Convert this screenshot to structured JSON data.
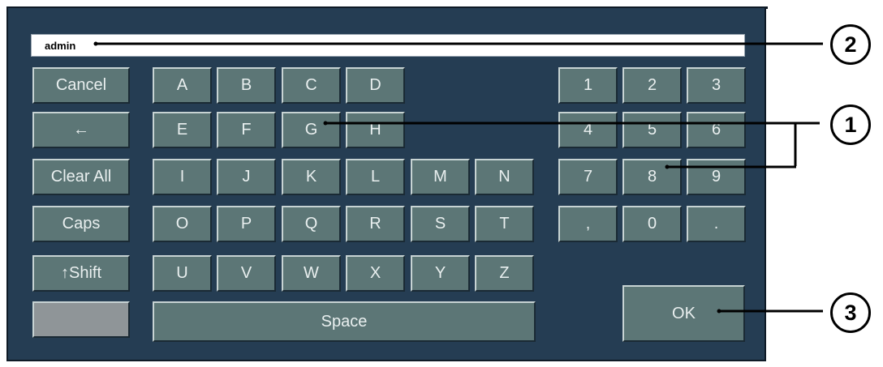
{
  "input": {
    "value": "admin"
  },
  "function_keys": [
    "Cancel",
    "←",
    "Clear All",
    "Caps",
    "↑Shift",
    ""
  ],
  "letter_rows": [
    [
      "A",
      "B",
      "C",
      "D"
    ],
    [
      "E",
      "F",
      "G",
      "H"
    ],
    [
      "I",
      "J",
      "K",
      "L",
      "M",
      "N"
    ],
    [
      "O",
      "P",
      "Q",
      "R",
      "S",
      "T"
    ],
    [
      "U",
      "V",
      "W",
      "X",
      "Y",
      "Z"
    ]
  ],
  "space_label": "Space",
  "numpad": [
    [
      "1",
      "2",
      "3"
    ],
    [
      "4",
      "5",
      "6"
    ],
    [
      "7",
      "8",
      "9"
    ],
    [
      ",",
      "0",
      "."
    ]
  ],
  "ok_label": "OK",
  "callouts": [
    "2",
    "1",
    "3"
  ],
  "colors": {
    "panel": "#253d53",
    "key": "#5c7676",
    "key_text": "#e9efef",
    "blank_key": "#8f9598"
  }
}
